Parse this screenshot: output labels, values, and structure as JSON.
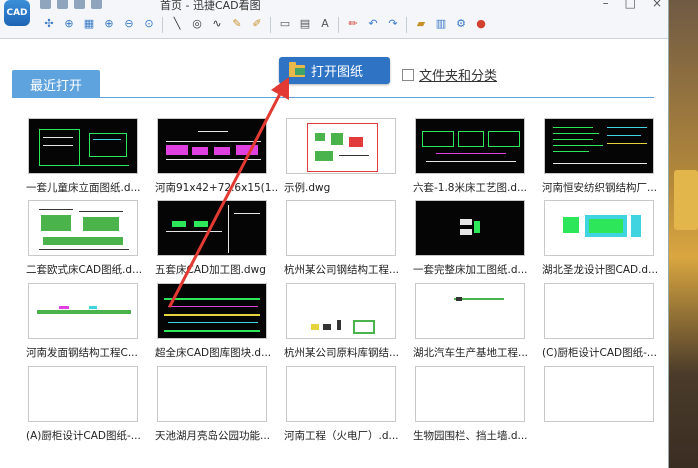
{
  "window": {
    "title": "首页 - 迅捷CAD看图",
    "logo_text": "CAD",
    "minimize": "–",
    "maximize": "□",
    "close": "×"
  },
  "toolbar": {
    "icons": [
      "add-icon",
      "locate-icon",
      "grid-icon",
      "zoom-in-icon",
      "zoom-out-icon",
      "zoom-fit-icon",
      "line-icon",
      "circle-icon",
      "polyline-icon",
      "freehand-icon",
      "erase-icon",
      "rectangle-icon",
      "table-icon",
      "text-icon",
      "pen-icon",
      "undo-icon",
      "redo-icon",
      "color-icon",
      "layers-icon",
      "settings-icon",
      "palette-icon"
    ]
  },
  "tabs": {
    "recent": "最近打开"
  },
  "open_button": {
    "label": "打开图纸"
  },
  "classify": {
    "label": "文件夹和分类"
  },
  "colors": {
    "accent": "#2f74c4",
    "tab": "#5fa3de",
    "arrow": "#e23a32"
  },
  "files": [
    {
      "name": "一套儿童床立面图纸.d...",
      "thumb": "dark"
    },
    {
      "name": "河南91x42+72.6x15(1...",
      "thumb": "dark"
    },
    {
      "name": "示例.dwg",
      "thumb": "light"
    },
    {
      "name": "六套-1.8米床工艺图.d...",
      "thumb": "dark"
    },
    {
      "name": "河南恒安纺织钢结构厂...",
      "thumb": "dark"
    },
    {
      "name": "二套欧式床CAD图纸.d...",
      "thumb": "light"
    },
    {
      "name": "五套床CAD加工图.dwg",
      "thumb": "dark"
    },
    {
      "name": "杭州某公司钢结构工程...",
      "thumb": "light"
    },
    {
      "name": "一套完整床加工图纸.d...",
      "thumb": "dark"
    },
    {
      "name": "湖北圣龙设计图CAD.d...",
      "thumb": "light"
    },
    {
      "name": "河南发面钢结构工程C...",
      "thumb": "light"
    },
    {
      "name": "超全床CAD图库图块.d...",
      "thumb": "dark"
    },
    {
      "name": "杭州某公司原料库钢结...",
      "thumb": "light"
    },
    {
      "name": "湖北汽车生产基地工程...",
      "thumb": "light"
    },
    {
      "name": "(C)厨柜设计CAD图纸-...",
      "thumb": "light"
    },
    {
      "name": "(A)厨柜设计CAD图纸-...",
      "thumb": "light"
    },
    {
      "name": "天池湖月亮岛公园功能...",
      "thumb": "light"
    },
    {
      "name": "河南工程（火电厂）.d...",
      "thumb": "light"
    },
    {
      "name": "生物园围栏、挡土墙.d...",
      "thumb": "light"
    },
    {
      "name": "",
      "thumb": "light"
    }
  ]
}
